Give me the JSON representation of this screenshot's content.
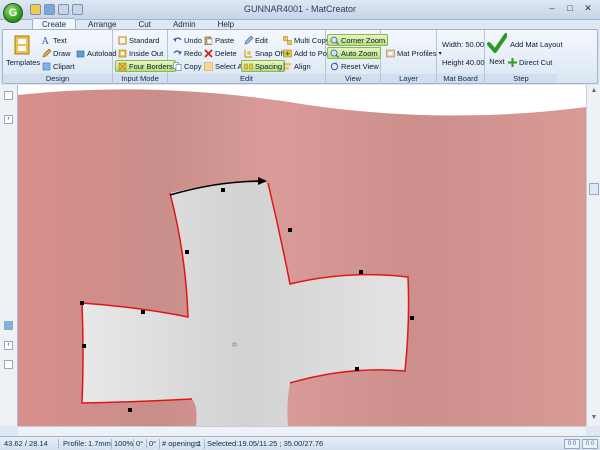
{
  "window": {
    "title": "GUNNAR4001 - MatCreator",
    "app_orb_letter": "G",
    "controls": [
      "–",
      "□",
      "✕"
    ]
  },
  "tabs": [
    "Create",
    "Arrange",
    "Cut",
    "Admin",
    "Help"
  ],
  "active_tab": "Create",
  "ribbon": {
    "design": {
      "label": "Design",
      "templates": "Templates",
      "text": "Text",
      "draw": "Draw",
      "clipart": "Clipart",
      "autoload": "Autoload"
    },
    "input_mode": {
      "label": "Input Mode",
      "standard": "Standard",
      "inside_out": "Inside Out",
      "four_borders": "Four Borders"
    },
    "edit": {
      "label": "Edit",
      "undo": "Undo",
      "redo": "Redo",
      "copy": "Copy",
      "paste": "Paste",
      "delete": "Delete",
      "select_all": "Select All",
      "edit": "Edit",
      "snap_off": "Snap Off",
      "spacing": "Spacing",
      "multi_copy": "Multi Copy",
      "add_to_pool": "Add to Pool",
      "align": "Align"
    },
    "view": {
      "label": "View",
      "corner_zoom": "Corner Zoom",
      "auto_zoom": "Auto Zoom",
      "reset_view": "Reset View"
    },
    "layer": {
      "label": "Layer",
      "mat_profiles": "Mat Profiles"
    },
    "mat_board_size": {
      "label": "Mat Board Size",
      "width": "Width: 50.00",
      "height": "Height 40.00"
    },
    "step": {
      "label": "Step",
      "next": "Next",
      "add_mat_layout": "Add Mat Layout",
      "direct_cut": "Direct Cut"
    }
  },
  "statusbar": {
    "coords": "43.62 / 28.14",
    "profile": "Profile:",
    "profile_value": "1.7mm",
    "zoom": "100%",
    "angle1": "0°",
    "angle2": "0°",
    "openings_label": "# openings:",
    "openings_value": "1",
    "selected": "Selected:19.05/11.25 ; 35.00/27.76",
    "zoom_btns": [
      "0 0",
      "0 0"
    ]
  },
  "colors": {
    "flag_red": "#d79692",
    "cross_fill": "#e2e2e2",
    "outline_red": "#e01515",
    "active_button": "#c2e58a"
  }
}
